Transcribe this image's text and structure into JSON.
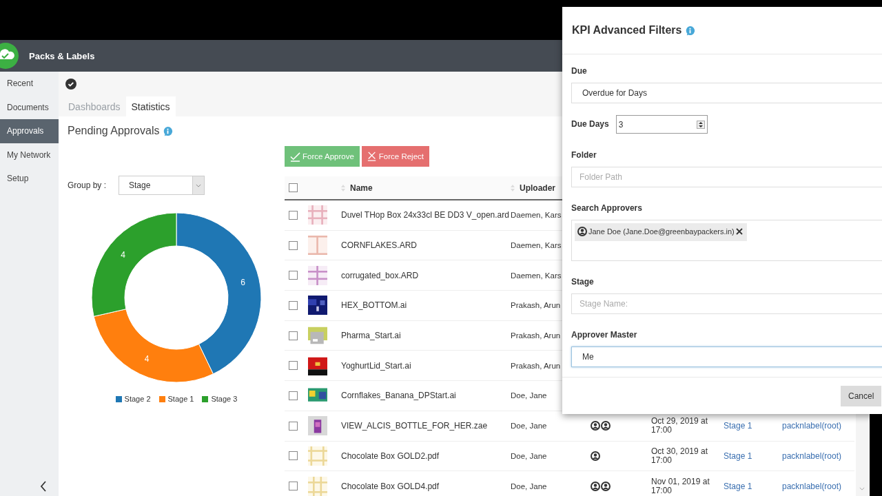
{
  "app": {
    "title": "Packs & Labels"
  },
  "sidebar": {
    "items": [
      {
        "label": "Recent",
        "selected": false
      },
      {
        "label": "Documents",
        "selected": false
      },
      {
        "label": "Approvals",
        "selected": true
      },
      {
        "label": "My Network",
        "selected": false
      },
      {
        "label": "Setup",
        "selected": false
      }
    ]
  },
  "tabs": [
    {
      "label": "Dashboards",
      "selected": false
    },
    {
      "label": "Statistics",
      "selected": true
    }
  ],
  "panel": {
    "title": "Pending Approvals",
    "group_by": {
      "label": "Group by :",
      "value": "Stage"
    },
    "chart_data": {
      "type": "donut",
      "categories": [
        "Stage 2",
        "Stage 1",
        "Stage 3"
      ],
      "colors": [
        "#1f77b4",
        "#ff7f0e",
        "#2ca02c"
      ],
      "series": [
        {
          "values": [
            6,
            4,
            4
          ]
        }
      ],
      "data_labels": true,
      "legend": true
    }
  },
  "actions": [
    {
      "label": "Force Approve",
      "kind": "approve"
    },
    {
      "label": "Force Reject",
      "kind": "reject"
    }
  ],
  "table": {
    "select_all": {
      "checked": false
    },
    "columns": [
      "Name",
      "Uploader"
    ],
    "rows": [
      {
        "checked": false,
        "name": "Duvel THop Box 24x33cl BE DD3 V_open.ard",
        "uploader": "Daemen, Kars"
      },
      {
        "checked": false,
        "name": "CORNFLAKES.ARD",
        "uploader": "Daemen, Kars"
      },
      {
        "checked": false,
        "name": "corrugated_box.ARD",
        "uploader": "Daemen, Kars"
      },
      {
        "checked": false,
        "name": "HEX_BOTTOM.ai",
        "uploader": "Prakash, Arun"
      },
      {
        "checked": false,
        "name": "Pharma_Start.ai",
        "uploader": "Prakash, Arun"
      },
      {
        "checked": false,
        "name": "YoghurtLid_Start.ai",
        "uploader": "Prakash, Arun"
      },
      {
        "checked": false,
        "name": "Cornflakes_Banana_DPStart.ai",
        "uploader": "Doe, Jane"
      },
      {
        "checked": false,
        "name": "VIEW_ALCIS_BOTTLE_FOR_HER.zae",
        "uploader": "Doe, Jane",
        "approvers": [
          {
            "kind": "user"
          },
          {
            "kind": "user"
          }
        ],
        "due": "Oct 29, 2019 at 17:00",
        "stage": "Stage 1",
        "owner": "packnlabel(root)"
      },
      {
        "checked": false,
        "name": "Chocolate Box GOLD2.pdf",
        "uploader": "Doe, Jane",
        "approvers": [
          {
            "kind": "user"
          }
        ],
        "due": "Oct 30, 2019 at 17:00",
        "stage": "Stage 1",
        "owner": "packnlabel(root)"
      },
      {
        "checked": false,
        "name": "Chocolate Box GOLD4.pdf",
        "uploader": "Doe, Jane",
        "approvers": [
          {
            "kind": "user"
          },
          {
            "kind": "user"
          }
        ],
        "due": "Nov 01, 2019 at 17:00",
        "stage": "Stage 1",
        "owner": "packnlabel(root)"
      }
    ]
  },
  "filters": {
    "title": "KPI Advanced Filters",
    "fields": [
      {
        "kind": "select",
        "label": "Due",
        "value": "Overdue for Days",
        "focused": false
      },
      {
        "kind": "number",
        "label": "Due Days",
        "value": "3",
        "focused": false
      },
      {
        "kind": "text",
        "label": "Folder",
        "placeholder": "Folder Path",
        "focused": false
      },
      {
        "kind": "tags",
        "label": "Search Approvers",
        "tags": [
          "Jane Doe (Jane.Doe@greenbaypackers.in)"
        ],
        "focused": false
      },
      {
        "kind": "text",
        "label": "Stage",
        "placeholder": "Stage Name:",
        "focused": false
      },
      {
        "kind": "select",
        "label": "Approver Master",
        "value": "Me",
        "focused": true
      }
    ],
    "buttons": [
      "Cancel"
    ]
  }
}
